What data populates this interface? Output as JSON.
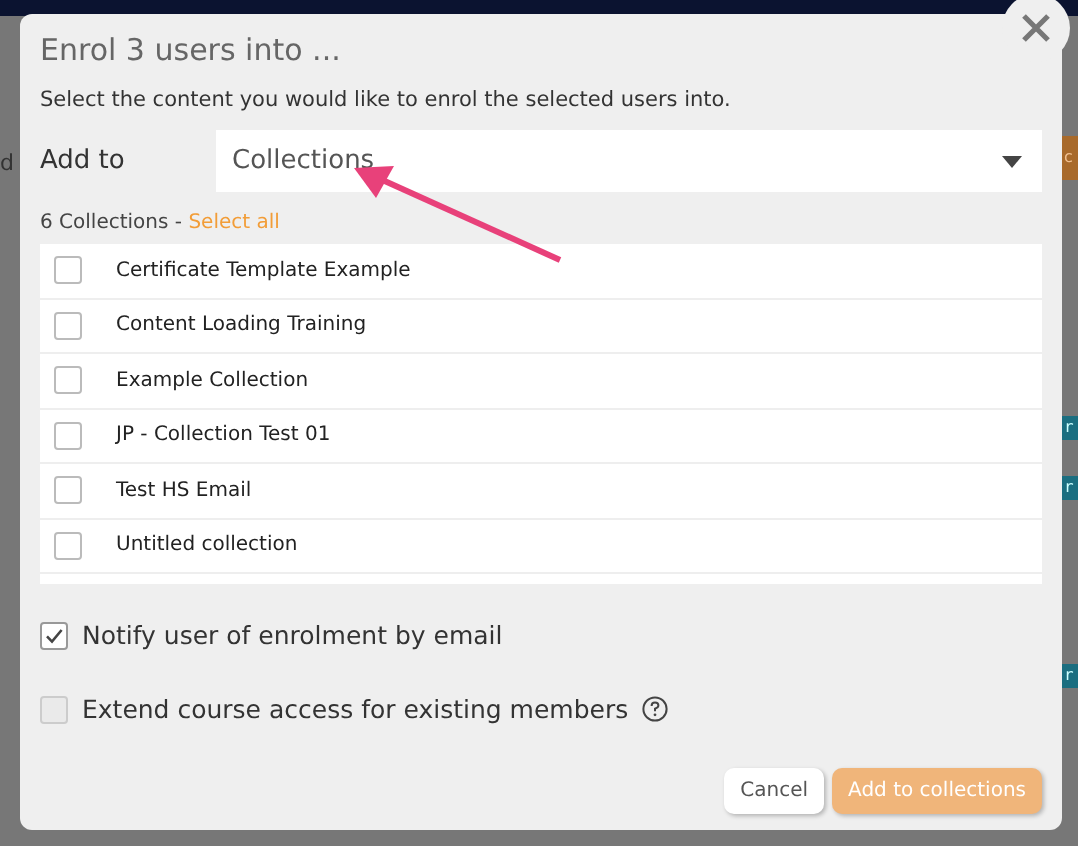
{
  "background": {
    "left_fragment": "d",
    "right_button_fragment": "c",
    "tags": [
      "r",
      "r",
      "r"
    ]
  },
  "dialog": {
    "title": "Enrol 3 users into ...",
    "subtitle": "Select the content you would like to enrol the selected users into.",
    "add_to": {
      "label": "Add to",
      "value": "Collections"
    },
    "count": "6 Collections - ",
    "select_all": "Select all",
    "items": [
      {
        "label": "Certificate Template Example",
        "checked": false
      },
      {
        "label": "Content Loading Training",
        "checked": false
      },
      {
        "label": "Example Collection",
        "checked": false
      },
      {
        "label": "JP - Collection Test 01",
        "checked": false
      },
      {
        "label": "Test HS Email",
        "checked": false
      },
      {
        "label": "Untitled collection",
        "checked": false
      }
    ],
    "options": [
      {
        "label": "Notify user of enrolment by email",
        "checked": true,
        "help": false
      },
      {
        "label": "Extend course access for existing members",
        "checked": false,
        "help": true
      }
    ],
    "buttons": [
      {
        "label": "Cancel",
        "kind": "secondary"
      },
      {
        "label": "Add to collections",
        "kind": "primary"
      }
    ]
  }
}
